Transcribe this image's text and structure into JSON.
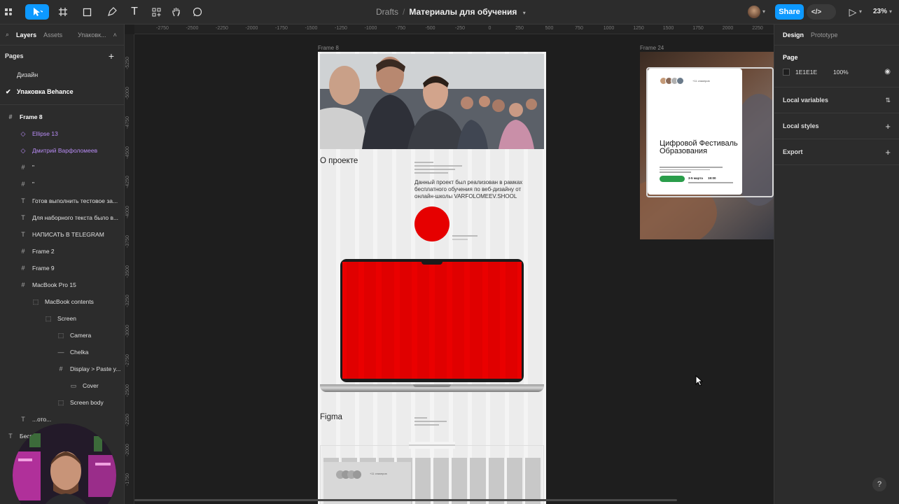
{
  "toolbar": {
    "breadcrumb_drafts": "Drafts",
    "separator": "/",
    "file_name": "Материалы для обучения",
    "share_label": "Share",
    "code_label": "</>",
    "play_label": "▷",
    "zoom": "23%"
  },
  "left_panel": {
    "tabs": {
      "layers": "Layers",
      "assets": "Assets",
      "page": "Упаковк..."
    },
    "pages_label": "Pages",
    "pages": [
      {
        "label": "Дизайн",
        "current": false
      },
      {
        "label": "Упаковка Behance",
        "current": true
      }
    ],
    "layers": [
      {
        "label": "Frame 8",
        "icon": "frame-icon"
      },
      {
        "label": "Ellipse 13",
        "icon": "component-instance-icon"
      },
      {
        "label": "Дмитрий Варфоломеев",
        "icon": "component-instance-icon"
      },
      {
        "label": "\"",
        "icon": "frame-icon"
      },
      {
        "label": "\"",
        "icon": "frame-icon"
      },
      {
        "label": "Готов выполнить тестовое за...",
        "icon": "text-icon"
      },
      {
        "label": "Для наборного текста было в...",
        "icon": "text-icon"
      },
      {
        "label": "НАПИСАТЬ В TELEGRAM",
        "icon": "text-icon"
      },
      {
        "label": "Frame 2",
        "icon": "frame-icon"
      },
      {
        "label": "Frame 9",
        "icon": "frame-icon"
      },
      {
        "label": "MacBook Pro 15",
        "icon": "frame-icon"
      },
      {
        "label": "MacBook contents",
        "icon": "group-icon"
      },
      {
        "label": "Screen",
        "icon": "group-icon"
      },
      {
        "label": "Camera",
        "icon": "group-icon"
      },
      {
        "label": "Chelka",
        "icon": "line-icon"
      },
      {
        "label": "Display > Paste y...",
        "icon": "frame-icon"
      },
      {
        "label": "Cover",
        "icon": "rectangle-icon"
      },
      {
        "label": "Screen body",
        "icon": "group-icon"
      },
      {
        "label": "...ото...",
        "icon": "text-icon"
      },
      {
        "label": "Беспл... ...ение по веб-...",
        "icon": "text-icon"
      }
    ]
  },
  "rulers": {
    "top": [
      "-2750",
      "-2500",
      "-2250",
      "-2000",
      "-1750",
      "-1500",
      "-1250",
      "-1000",
      "-750",
      "-500",
      "-250",
      "0",
      "250",
      "500",
      "750",
      "1000",
      "1250",
      "1500",
      "1750",
      "2000",
      "2250"
    ],
    "left": [
      "-5250",
      "-5000",
      "-4750",
      "-4500",
      "-4250",
      "-4000",
      "-3750",
      "-3500",
      "-3250",
      "-3000",
      "-2750",
      "-2500",
      "-2250",
      "-2000",
      "-1750"
    ]
  },
  "canvas": {
    "frame8_label": "Frame 8",
    "frame24_label": "Frame 24",
    "about_title": "О проекте",
    "about_text": "Данный проект был реализован в рамках бесплатного обучения по веб-дизайну от онлайн-школы VARFOLOMEEV.SHOOL",
    "figma_title": "Figma",
    "card_title": "Цифровой Фестиваль Образования",
    "card_dates": "3-5 марта",
    "card_time": "19:00",
    "card_tag": "+11 спикеров",
    "bottom_tag": "+11 спикеров",
    "accent_red": "#e60000",
    "accent_green": "#2a9d4a"
  },
  "right_panel": {
    "tabs": {
      "design": "Design",
      "prototype": "Prototype"
    },
    "page_label": "Page",
    "page_color": "1E1E1E",
    "page_opacity": "100%",
    "sections": [
      {
        "label": "Local variables",
        "action": "⇅"
      },
      {
        "label": "Local styles",
        "action": "+"
      },
      {
        "label": "Export",
        "action": "+"
      }
    ]
  },
  "help_label": "?"
}
